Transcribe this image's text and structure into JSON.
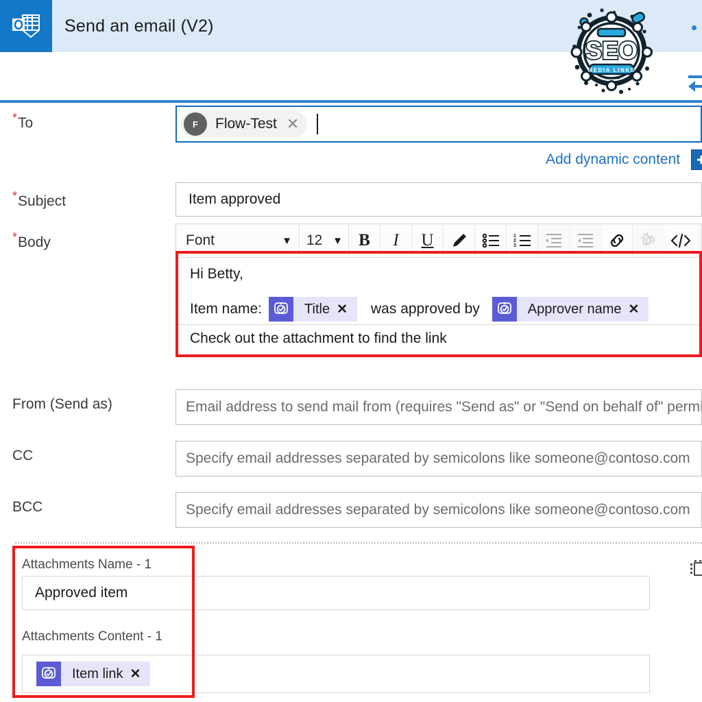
{
  "header": {
    "app_icon": "outlook-icon",
    "title": "Send an email (V2)",
    "logo_text_main": "SEO",
    "logo_text_sub": "MEDIA LINKS"
  },
  "toolbar_right": {
    "collapse_icon": "collapse-left-arrow-icon"
  },
  "form": {
    "to": {
      "label": "To",
      "required": true,
      "chip": {
        "avatar_initial": "F",
        "name": "Flow-Test",
        "remove_icon": "close-icon"
      }
    },
    "dynamic_content": {
      "link_label": "Add dynamic content",
      "button_icon": "dynamic-content-icon"
    },
    "subject": {
      "label": "Subject",
      "required": true,
      "value": "Item approved"
    },
    "body": {
      "label": "Body",
      "required": true,
      "toolbar": {
        "font_select": "Font",
        "size_select": "12",
        "buttons": [
          {
            "name": "bold-button",
            "glyph": "B"
          },
          {
            "name": "italic-button",
            "glyph": "I"
          },
          {
            "name": "underline-button",
            "glyph": "U"
          },
          {
            "name": "text-highlight-button",
            "glyph": "pen-icon"
          },
          {
            "name": "bullet-list-button",
            "glyph": "bullet-list-icon"
          },
          {
            "name": "numbered-list-button",
            "glyph": "numbered-list-icon"
          },
          {
            "name": "decrease-indent-button",
            "glyph": "decrease-indent-icon"
          },
          {
            "name": "increase-indent-button",
            "glyph": "increase-indent-icon"
          },
          {
            "name": "insert-link-button",
            "glyph": "link-icon"
          },
          {
            "name": "remove-link-button",
            "glyph": "unlink-icon"
          },
          {
            "name": "code-view-button",
            "glyph": "code-icon"
          }
        ]
      },
      "content": {
        "line1": "Hi Betty,",
        "line2_prefix": "Item name:",
        "token1": "Title",
        "line2_middle": "was approved by",
        "token2": "Approver name",
        "line3": "Check out the attachment to find the link"
      }
    },
    "from": {
      "label": "From (Send as)",
      "placeholder": "Email address to send mail from (requires \"Send as\" or \"Send on behalf of\" permissions)"
    },
    "cc": {
      "label": "CC",
      "placeholder": "Specify email addresses separated by semicolons like someone@contoso.com"
    },
    "bcc": {
      "label": "BCC",
      "placeholder": "Specify email addresses separated by semicolons like someone@contoso.com"
    },
    "attachments": {
      "name_label": "Attachments Name - 1",
      "name_value": "Approved item",
      "content_label": "Attachments Content - 1",
      "content_token": "Item link",
      "row_action_icon": "copy-icon"
    }
  },
  "colors": {
    "accent_blue": "#1478c8",
    "header_band": "#dce9f7",
    "link_blue": "#1f6fc4",
    "highlight_red": "#ee1c1c",
    "token_purple": "#5b5bd6",
    "token_bg": "#e6e4f8",
    "required_red": "#d13438"
  }
}
